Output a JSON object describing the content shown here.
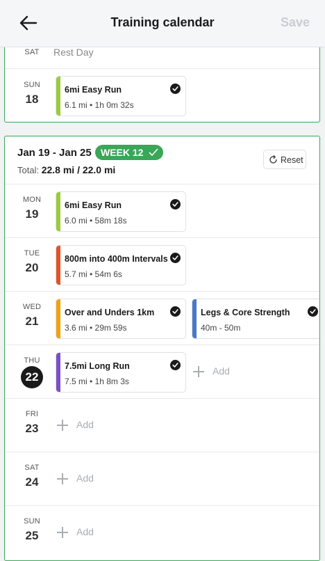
{
  "header": {
    "title": "Training calendar",
    "save_label": "Save",
    "back_icon": "arrow-left-icon"
  },
  "prev_week": {
    "sat": {
      "dow": "SAT",
      "rest_label": "Rest Day"
    },
    "sun": {
      "dow": "SUN",
      "date": "18",
      "workout": {
        "title": "6mi Easy Run",
        "meta": "6.1 mi • 1h 0m 32s",
        "color": "#9ccc3a",
        "completed": true
      }
    }
  },
  "week": {
    "range": "Jan 19 - Jan 25",
    "badge": "WEEK 12",
    "total_label": "Total:",
    "total_value": "22.8 mi / 22.0 mi",
    "reset_label": "Reset",
    "add_label": "Add",
    "days": [
      {
        "dow": "MON",
        "date": "19",
        "workouts": [
          {
            "title": "6mi Easy Run",
            "meta": "6.0 mi • 58m 18s",
            "color": "#9ccc3a",
            "completed": true
          }
        ]
      },
      {
        "dow": "TUE",
        "date": "20",
        "workouts": [
          {
            "title": "800m into 400m Intervals",
            "meta": "5.7 mi • 54m 6s",
            "color": "#e55324",
            "completed": true
          }
        ]
      },
      {
        "dow": "WED",
        "date": "21",
        "workouts": [
          {
            "title": "Over and Unders 1km",
            "meta": "3.6 mi • 29m 59s",
            "color": "#f1a213",
            "completed": true
          },
          {
            "title": "Legs & Core Strength",
            "meta": "40m - 50m",
            "color": "#4a78c9",
            "completed": true
          }
        ]
      },
      {
        "dow": "THU",
        "date": "22",
        "today": true,
        "workouts": [
          {
            "title": "7.5mi Long Run",
            "meta": "7.5 mi • 1h 8m 3s",
            "color": "#7b4fc6",
            "completed": true
          }
        ]
      },
      {
        "dow": "FRI",
        "date": "23",
        "workouts": []
      },
      {
        "dow": "SAT",
        "date": "24",
        "workouts": []
      },
      {
        "dow": "SUN",
        "date": "25",
        "workouts": []
      }
    ]
  }
}
